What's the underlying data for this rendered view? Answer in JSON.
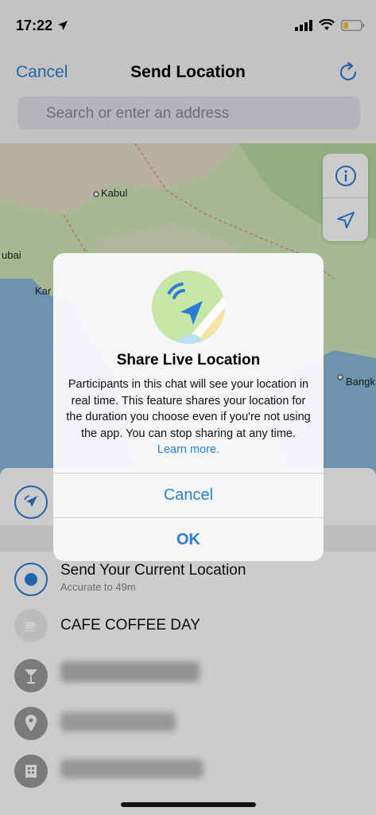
{
  "status_bar": {
    "time": "17:22"
  },
  "nav": {
    "cancel_label": "Cancel",
    "title": "Send Location"
  },
  "search": {
    "placeholder": "Search or enter an address"
  },
  "map": {
    "labels": [
      "Kabul",
      "ubai",
      "Kar",
      "Bangk"
    ]
  },
  "list": {
    "current_location": {
      "title": "Send Your Current Location",
      "subtitle": "Accurate to 49m"
    },
    "places": [
      {
        "name": "CAFE COFFEE DAY",
        "icon": "coffee-cup-icon"
      },
      {
        "name": "",
        "icon": "cocktail-icon"
      },
      {
        "name": "",
        "icon": "location-pin-icon"
      },
      {
        "name": "",
        "icon": "building-icon"
      }
    ]
  },
  "alert": {
    "title": "Share Live Location",
    "body": "Participants in this chat will see your location in real time. This feature shares your location for the duration you choose even if you're not using the app. You can stop sharing at any time.",
    "link": "Learn more.",
    "cancel_label": "Cancel",
    "ok_label": "OK"
  },
  "colors": {
    "accent": "#2c7dd4",
    "map_land": "#cfe6b6",
    "map_water": "#8ab8d9"
  }
}
